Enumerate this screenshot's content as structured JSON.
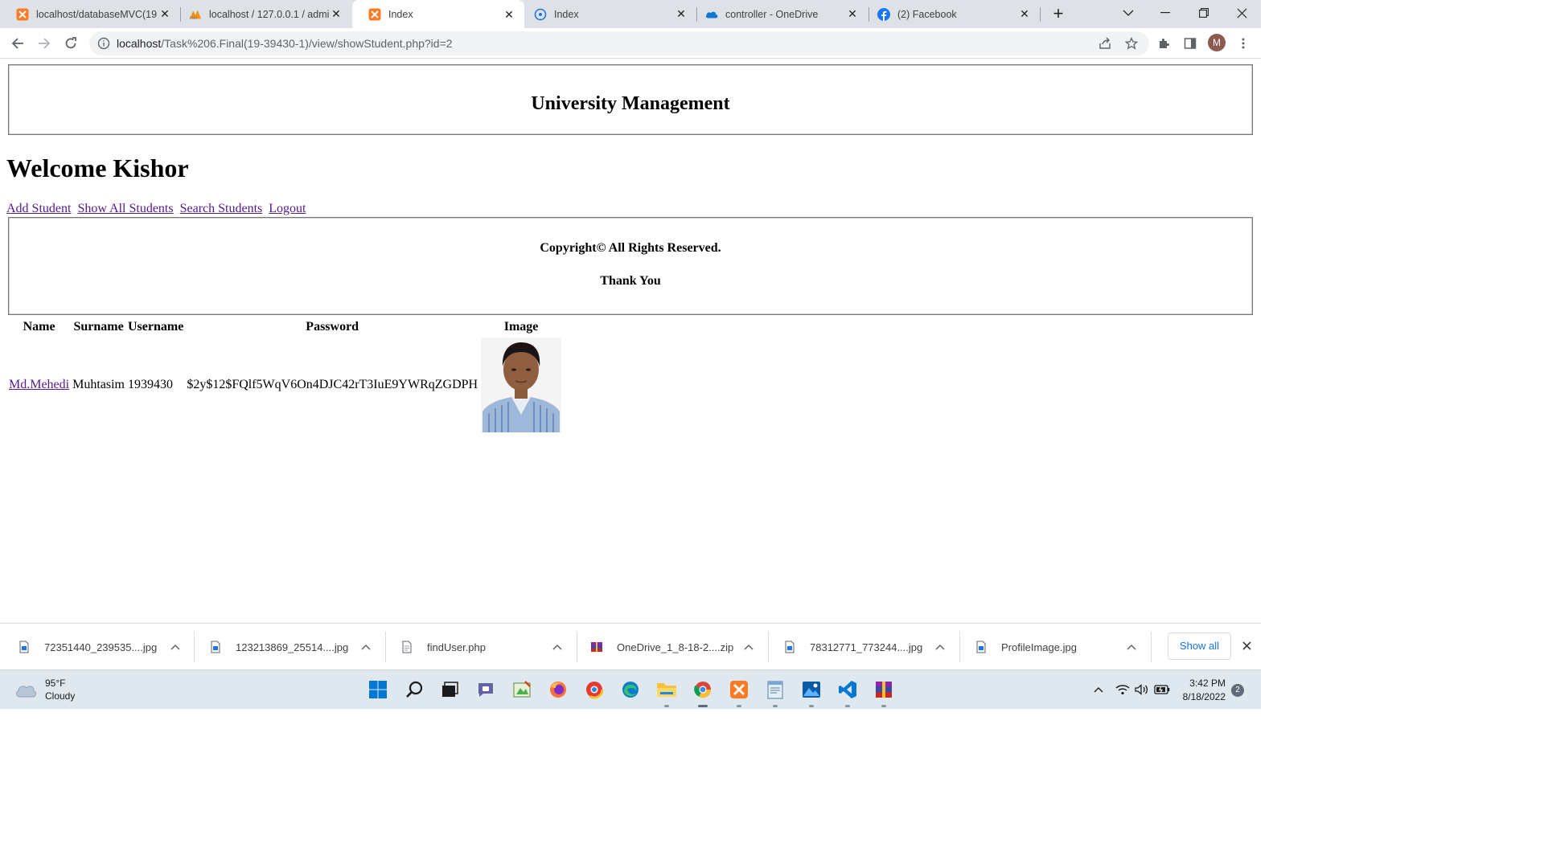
{
  "browser": {
    "tabs": [
      {
        "title": "localhost/databaseMVC(19",
        "icon": "xampp-icon"
      },
      {
        "title": "localhost / 127.0.0.1 / admi",
        "icon": "phpmyadmin-icon"
      },
      {
        "title": "Index",
        "icon": "xampp-icon"
      },
      {
        "title": "Index",
        "icon": "globe-icon"
      },
      {
        "title": "controller - OneDrive",
        "icon": "onedrive-icon"
      },
      {
        "title": "(2) Facebook",
        "icon": "facebook-icon"
      }
    ],
    "url_host": "localhost",
    "url_path": "/Task%206.Final(19-39430-1)/view/showStudent.php?id=2",
    "avatar_letter": "M"
  },
  "page": {
    "header_title": "University Management",
    "welcome": "Welcome Kishor",
    "nav_links": [
      "Add Student",
      "Show All Students",
      "Search Students",
      "Logout"
    ],
    "footer_copyright": "Copyright© All Rights Reserved.",
    "footer_thanks": "Thank You",
    "table": {
      "headers": [
        "Name",
        "Surname",
        "Username",
        "Password",
        "Image"
      ],
      "rows": [
        {
          "name": "Md.Mehedi",
          "surname": "Muhtasim",
          "username": "1939430",
          "password": "$2y$12$FQlf5WqV6On4DJC42rT3IuE9YWRqZGDPH",
          "image": "profile-photo"
        }
      ]
    }
  },
  "downloads": {
    "items": [
      {
        "filename": "72351440_239535....jpg",
        "icon": "image-file-icon"
      },
      {
        "filename": "123213869_25514....jpg",
        "icon": "image-file-icon"
      },
      {
        "filename": "findUser.php",
        "icon": "document-file-icon"
      },
      {
        "filename": "OneDrive_1_8-18-2....zip",
        "icon": "archive-file-icon"
      },
      {
        "filename": "78312771_773244....jpg",
        "icon": "image-file-icon"
      },
      {
        "filename": "ProfileImage.jpg",
        "icon": "image-file-icon"
      }
    ],
    "show_all": "Show all"
  },
  "taskbar": {
    "weather_temp": "95°F",
    "weather_desc": "Cloudy",
    "time": "3:42 PM",
    "date": "8/18/2022",
    "notification_count": "2"
  },
  "colors": {
    "link_visited": "#551a8b",
    "tabstrip_bg": "#dee1e6",
    "accent_blue": "#1a73e8"
  }
}
